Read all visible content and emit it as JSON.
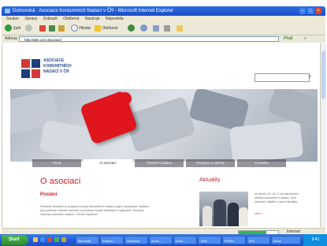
{
  "window": {
    "title": "Domovská · Asociace Konzumních Nadací v ČR - Microsoft Internet Explorer"
  },
  "menubar": {
    "items": [
      "Soubor",
      "Úpravy",
      "Zobrazit",
      "Oblíbené",
      "Nástroje",
      "Nápověda"
    ]
  },
  "toolbar": {
    "back": "Zpět",
    "search": "Hledat",
    "favorites": "Oblíbené"
  },
  "address": {
    "label": "Adresa",
    "url": "http://akn.cz/o-asociaci/",
    "go": "Přejít",
    "links": "»"
  },
  "header": {
    "org_name": [
      "ASOCIACE",
      "KOMUNITNÍCH",
      "NADACÍ V ČR"
    ],
    "search_placeholder": ""
  },
  "tabs": [
    "Úvod",
    "O asociaci",
    "Členské nadace",
    "Program a aktivity",
    "Kontakty"
  ],
  "main": {
    "title": "O asociaci",
    "subhead": "Poslání",
    "body": "Posláním asociace je podpora rozvoje komunitních nadací a jejich spolupráce. Nadace jsou partnery místních komunit a pomáhají rozvíjet filantropii v regionech. Asociace sdružuje komunitní nadace v České republice."
  },
  "news": {
    "title": "Aktuality",
    "text": "Ve dnech 23.–24. 3. se uskutečnilo setkání komunitních nadací. Více informací najdete v sekci Aktuality.",
    "link": "více »"
  },
  "status": {
    "zone": "Internet",
    "progress": 0.7
  },
  "taskbar": {
    "start": "Start",
    "buttons": [
      "Microsoft",
      "Komun...",
      "Windows",
      "Asoci...",
      "Doku...",
      "Total",
      "Firefox",
      "Win",
      "Nová"
    ],
    "clock": "9:41"
  },
  "colors": {
    "accent_red": "#c8202b",
    "brand_blue": "#1b3f7a"
  }
}
